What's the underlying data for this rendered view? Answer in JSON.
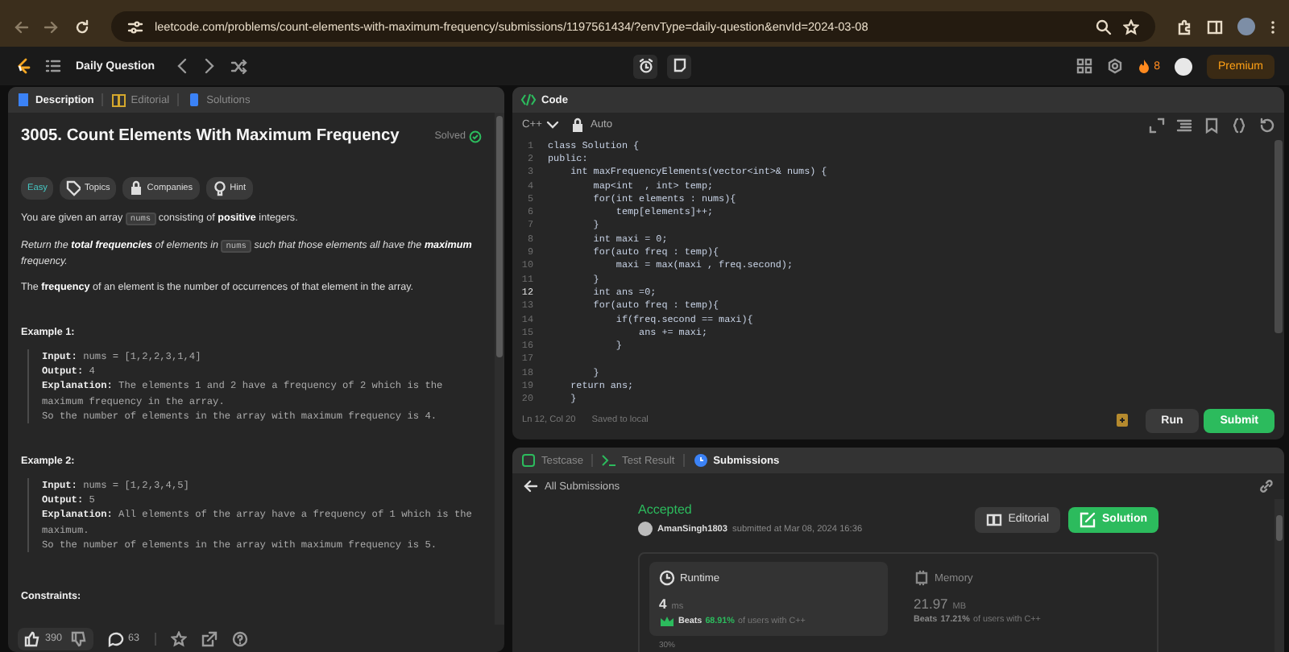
{
  "browser": {
    "url": "leetcode.com/problems/count-elements-with-maximum-frequency/submissions/1197561434/?envType=daily-question&envId=2024-03-08"
  },
  "nav": {
    "title": "Daily Question",
    "streak": "8",
    "premium": "Premium"
  },
  "description": {
    "tabs": [
      {
        "label": "Description",
        "selected": true
      },
      {
        "label": "Editorial",
        "selected": false
      },
      {
        "label": "Solutions",
        "selected": false
      }
    ],
    "title": "3005. Count Elements With Maximum Frequency",
    "status": "Solved",
    "tags": [
      {
        "label": "Easy",
        "kind": "difficulty"
      },
      {
        "label": "Topics",
        "kind": "topics"
      },
      {
        "label": "Companies",
        "kind": "companies"
      },
      {
        "label": "Hint",
        "kind": "hint"
      }
    ],
    "paragraphs": [
      {
        "kind": "plain",
        "parts": [
          {
            "kind": "text",
            "text": "You are given an array "
          },
          {
            "kind": "code",
            "text": "nums"
          },
          {
            "kind": "text",
            "text": " consisting of **positive** integers."
          }
        ]
      },
      {
        "kind": "italic",
        "parts": [
          {
            "kind": "text",
            "text": "Return the **total frequencies** of elements in "
          },
          {
            "kind": "code",
            "text": "nums"
          },
          {
            "kind": "text",
            "text": " such that those elements all have the **maximum** frequency."
          }
        ]
      },
      {
        "kind": "plain",
        "parts": [
          {
            "kind": "text",
            "text": "The **frequency** of an element is the number of occurrences of that element in the array."
          }
        ]
      }
    ],
    "examples": [
      {
        "heading": "Example 1:",
        "lines": [
          "**Input:** nums = [1,2,2,3,1,4]",
          "**Output:** 4",
          "**Explanation:** The elements 1 and 2 have a frequency of 2 which is the maximum frequency in the array.",
          "So the number of elements in the array with maximum frequency is 4."
        ]
      },
      {
        "heading": "Example 2:",
        "lines": [
          "**Input:** nums = [1,2,3,4,5]",
          "**Output:** 5",
          "**Explanation:** All elements of the array have a frequency of 1 which is the maximum.",
          "So the number of elements in the array with maximum frequency is 5."
        ]
      }
    ],
    "constraints_heading": "Constraints:",
    "likes": "390",
    "comments": "63"
  },
  "code": {
    "title": "Code",
    "language": "C++",
    "mode": "Auto",
    "lines": [
      {
        "number": "1",
        "text": "class Solution {",
        "active": false
      },
      {
        "number": "2",
        "text": "public:",
        "active": false
      },
      {
        "number": "3",
        "text": "    int maxFrequencyElements(vector<int>& nums) {",
        "active": false
      },
      {
        "number": "4",
        "text": "        map<int  , int> temp;",
        "active": false
      },
      {
        "number": "5",
        "text": "        for(int elements : nums){",
        "active": false
      },
      {
        "number": "6",
        "text": "            temp[elements]++;",
        "active": false
      },
      {
        "number": "7",
        "text": "        }",
        "active": false
      },
      {
        "number": "8",
        "text": "        int maxi = 0;",
        "active": false
      },
      {
        "number": "9",
        "text": "        for(auto freq : temp){",
        "active": false
      },
      {
        "number": "10",
        "text": "            maxi = max(maxi , freq.second);",
        "active": false
      },
      {
        "number": "11",
        "text": "        }",
        "active": false
      },
      {
        "number": "12",
        "text": "        int ans =0;",
        "active": true
      },
      {
        "number": "13",
        "text": "        for(auto freq : temp){",
        "active": false
      },
      {
        "number": "14",
        "text": "            if(freq.second == maxi){",
        "active": false
      },
      {
        "number": "15",
        "text": "                ans += maxi;",
        "active": false
      },
      {
        "number": "16",
        "text": "            }",
        "active": false
      },
      {
        "number": "17",
        "active": false
      },
      {
        "number": "18",
        "text": "        }",
        "active": false
      },
      {
        "number": "19",
        "text": "    return ans;",
        "active": false
      },
      {
        "number": "20",
        "text": "    }",
        "active": false
      }
    ],
    "cursor": "Ln 12, Col 20",
    "saved": "Saved to local",
    "run": "Run",
    "submit": "Submit"
  },
  "results": {
    "tabs": [
      {
        "label": "Testcase",
        "selected": false
      },
      {
        "label": "Test Result",
        "selected": false
      },
      {
        "label": "Submissions",
        "selected": true
      }
    ],
    "back": "All Submissions",
    "verdict": "Accepted",
    "user": "AmanSingh1803",
    "submitted": "submitted at Mar 08, 2024 16:36",
    "editorial": "Editorial",
    "solution": "Solution",
    "stats": [
      {
        "kind": "runtime",
        "label": "Runtime",
        "value": "4",
        "unit": "ms",
        "beats": "Beats",
        "percent": "68.91%",
        "suffix": "of users with C++",
        "selected": true
      },
      {
        "kind": "memory",
        "label": "Memory",
        "value": "21.97",
        "unit": "MB",
        "beats": "Beats",
        "percent": "17.21%",
        "suffix": "of users with C++",
        "selected": false
      }
    ],
    "axis_label": "30%"
  }
}
